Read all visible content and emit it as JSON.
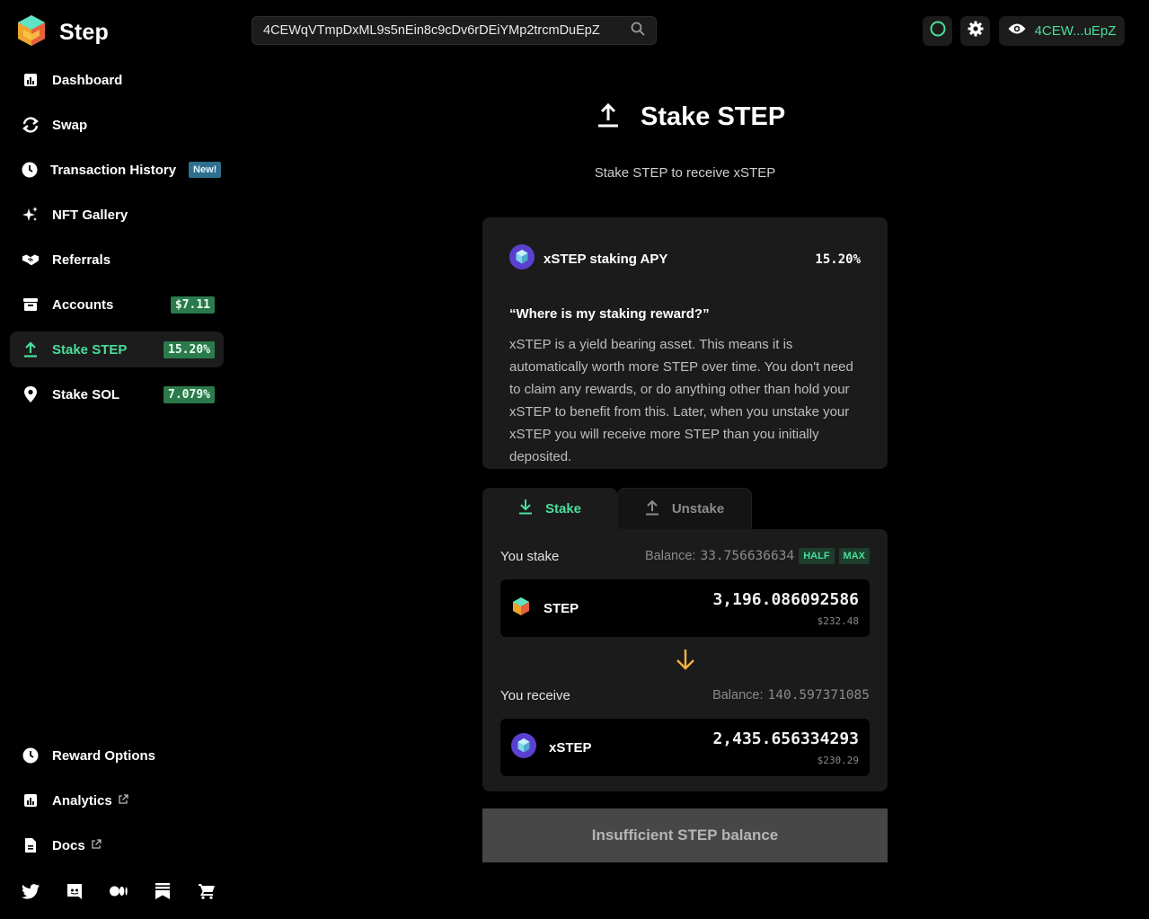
{
  "app": {
    "name": "Step"
  },
  "search": {
    "value": "4CEWqVTmpDxML9s5nEin8c9cDv6rDEiYMp2trcmDuEpZ"
  },
  "header": {
    "wallet_label": "4CEW...uEpZ"
  },
  "sidebar": {
    "items": [
      {
        "label": "Dashboard",
        "icon": "bar-chart-icon"
      },
      {
        "label": "Swap",
        "icon": "swap-icon"
      },
      {
        "label": "Transaction History",
        "icon": "clock-icon",
        "tag": "New!"
      },
      {
        "label": "NFT Gallery",
        "icon": "sparkle-icon"
      },
      {
        "label": "Referrals",
        "icon": "handshake-icon"
      },
      {
        "label": "Accounts",
        "icon": "archive-icon",
        "badge": "$7.11"
      },
      {
        "label": "Stake STEP",
        "icon": "upload-icon",
        "badge": "15.20%",
        "active": true
      },
      {
        "label": "Stake SOL",
        "icon": "location-pin-icon",
        "badge": "7.079%"
      }
    ],
    "bottom_items": [
      {
        "label": "Reward Options",
        "icon": "clock-icon"
      },
      {
        "label": "Analytics",
        "icon": "bar-chart-icon",
        "external": true
      },
      {
        "label": "Docs",
        "icon": "document-icon",
        "external": true
      }
    ],
    "socials": [
      "twitter-icon",
      "discord-icon",
      "medium-icon",
      "bookmark-icon",
      "cart-icon"
    ]
  },
  "page": {
    "title": "Stake STEP",
    "subtitle": "Stake STEP to receive xSTEP"
  },
  "info": {
    "apy_label": "xSTEP staking APY",
    "apy_value": "15.20%",
    "question": "“Where is my staking reward?”",
    "explanation": "xSTEP is a yield bearing asset. This means it is automatically worth more STEP over time. You don't need to claim any rewards, or do anything other than hold your xSTEP to benefit from this. Later, when you unstake your xSTEP you will receive more STEP than you initially deposited."
  },
  "tabs": {
    "stake": "Stake",
    "unstake": "Unstake"
  },
  "stake_form": {
    "you_stake": "You stake",
    "stake_balance_label": "Balance:",
    "stake_balance": "33.756636634",
    "half": "HALF",
    "max": "MAX",
    "stake_token": "STEP",
    "stake_amount": "3,196.086092586",
    "stake_usd": "$232.48",
    "you_receive": "You receive",
    "receive_balance_label": "Balance:",
    "receive_balance": "140.597371085",
    "receive_token": "xSTEP",
    "receive_amount": "2,435.656334293",
    "receive_usd": "$230.29",
    "submit": "Insufficient STEP balance"
  },
  "colors": {
    "accent": "#4ade9c",
    "arrow": "#f5b23c",
    "panel": "#1b1b1b"
  }
}
